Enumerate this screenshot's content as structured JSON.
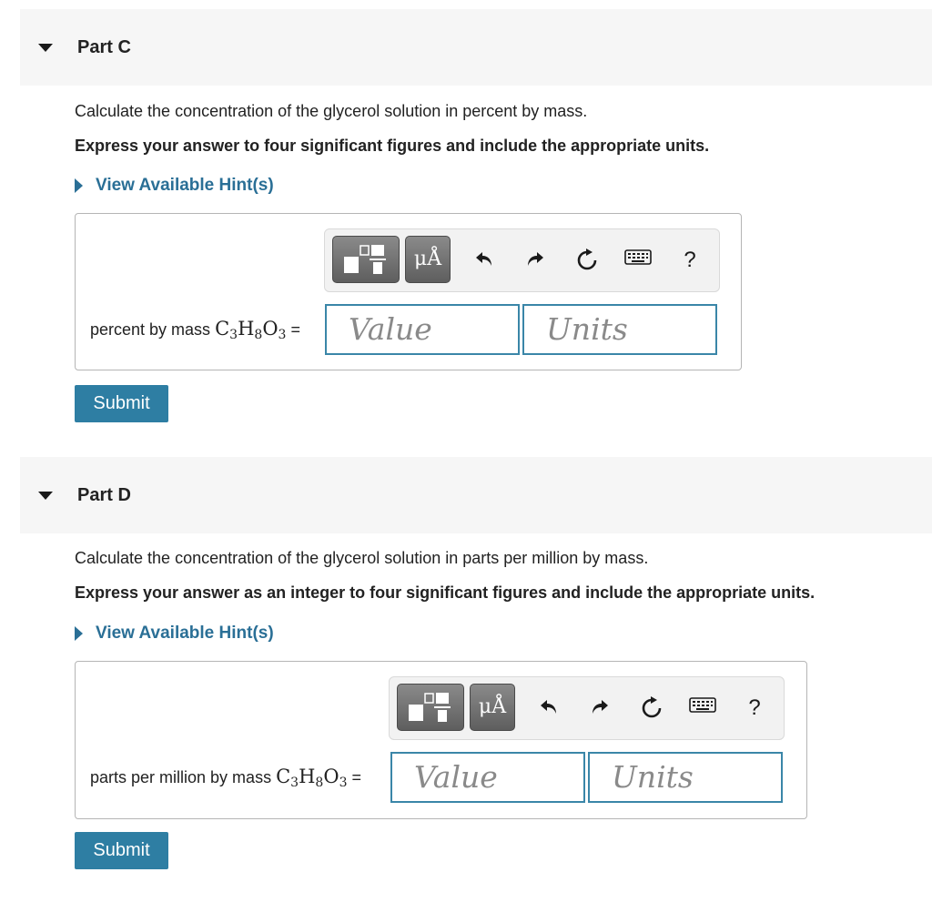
{
  "parts": [
    {
      "title": "Part C",
      "question": "Calculate the concentration of the glycerol solution in percent by mass.",
      "instruction": "Express your answer to four significant figures and include the appropriate units.",
      "hint_label": "View Available Hint(s)",
      "field_label": "percent by mass",
      "formula": {
        "c": "C",
        "c_sub": "3",
        "h": "H",
        "h_sub": "8",
        "o": "O",
        "o_sub": "3"
      },
      "equals": "=",
      "value_placeholder": "Value",
      "units_placeholder": "Units",
      "submit_label": "Submit"
    },
    {
      "title": "Part D",
      "question": "Calculate the concentration of the glycerol solution in parts per million by mass.",
      "instruction": "Express your answer as an integer to four significant figures and include the appropriate units.",
      "hint_label": "View Available Hint(s)",
      "field_label": "parts per million by mass",
      "formula": {
        "c": "C",
        "c_sub": "3",
        "h": "H",
        "h_sub": "8",
        "o": "O",
        "o_sub": "3"
      },
      "equals": "=",
      "value_placeholder": "Value",
      "units_placeholder": "Units",
      "submit_label": "Submit"
    }
  ],
  "toolbar": {
    "units_button_label": "μÅ",
    "help_label": "?",
    "icons": [
      "templates-icon",
      "units-icon",
      "undo-icon",
      "redo-icon",
      "reset-icon",
      "keyboard-icon",
      "help-icon"
    ]
  },
  "colors": {
    "accent": "#2e7ea3",
    "hint_link": "#2a6f96",
    "input_border": "#3a86a8",
    "header_bg": "#f6f6f6"
  }
}
